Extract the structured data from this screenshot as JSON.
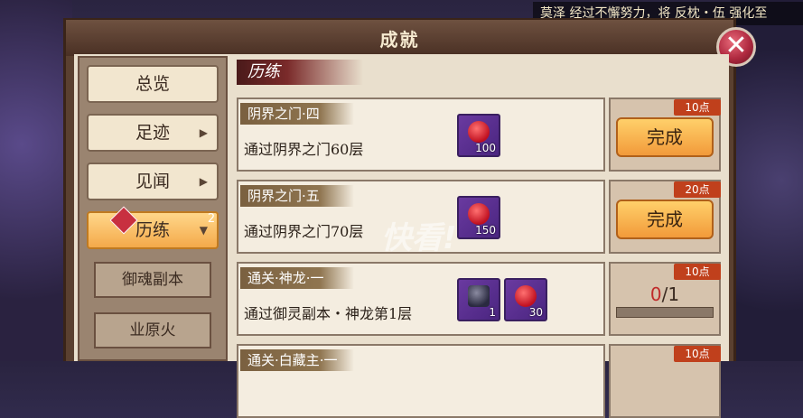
{
  "ticker": "莫泽 经过不懈努力，将 反枕・伍 强化至",
  "window": {
    "title": "成就",
    "close": "✕"
  },
  "sidebar": {
    "items": [
      {
        "label": "总览",
        "arrow": ""
      },
      {
        "label": "足迹",
        "arrow": "▶"
      },
      {
        "label": "见闻",
        "arrow": "▶"
      },
      {
        "label": "历练",
        "arrow": "▼",
        "badge": "2"
      }
    ],
    "subitems": [
      {
        "label": "御魂副本"
      },
      {
        "label": "业原火"
      }
    ]
  },
  "section": {
    "title": "历练"
  },
  "achievements": [
    {
      "title": "阴界之门·四",
      "desc": "通过阴界之门60层",
      "points": "10点",
      "rewards": [
        {
          "icon": "red-orb-icon",
          "count": "100"
        }
      ],
      "action": "完成"
    },
    {
      "title": "阴界之门·五",
      "desc": "通过阴界之门70层",
      "points": "20点",
      "rewards": [
        {
          "icon": "red-orb-icon",
          "count": "150"
        }
      ],
      "action": "完成"
    },
    {
      "title": "通关·神龙·一",
      "desc": "通过御灵副本・神龙第1层",
      "points": "10点",
      "rewards": [
        {
          "icon": "dark-stone-icon",
          "count": "1"
        },
        {
          "icon": "red-orb-icon",
          "count": "30"
        }
      ],
      "progress": {
        "current": "0",
        "total": "/1",
        "fraction": 0
      }
    },
    {
      "title": "通关·白藏主·一",
      "points": "10点"
    }
  ],
  "watermark": "快看!"
}
